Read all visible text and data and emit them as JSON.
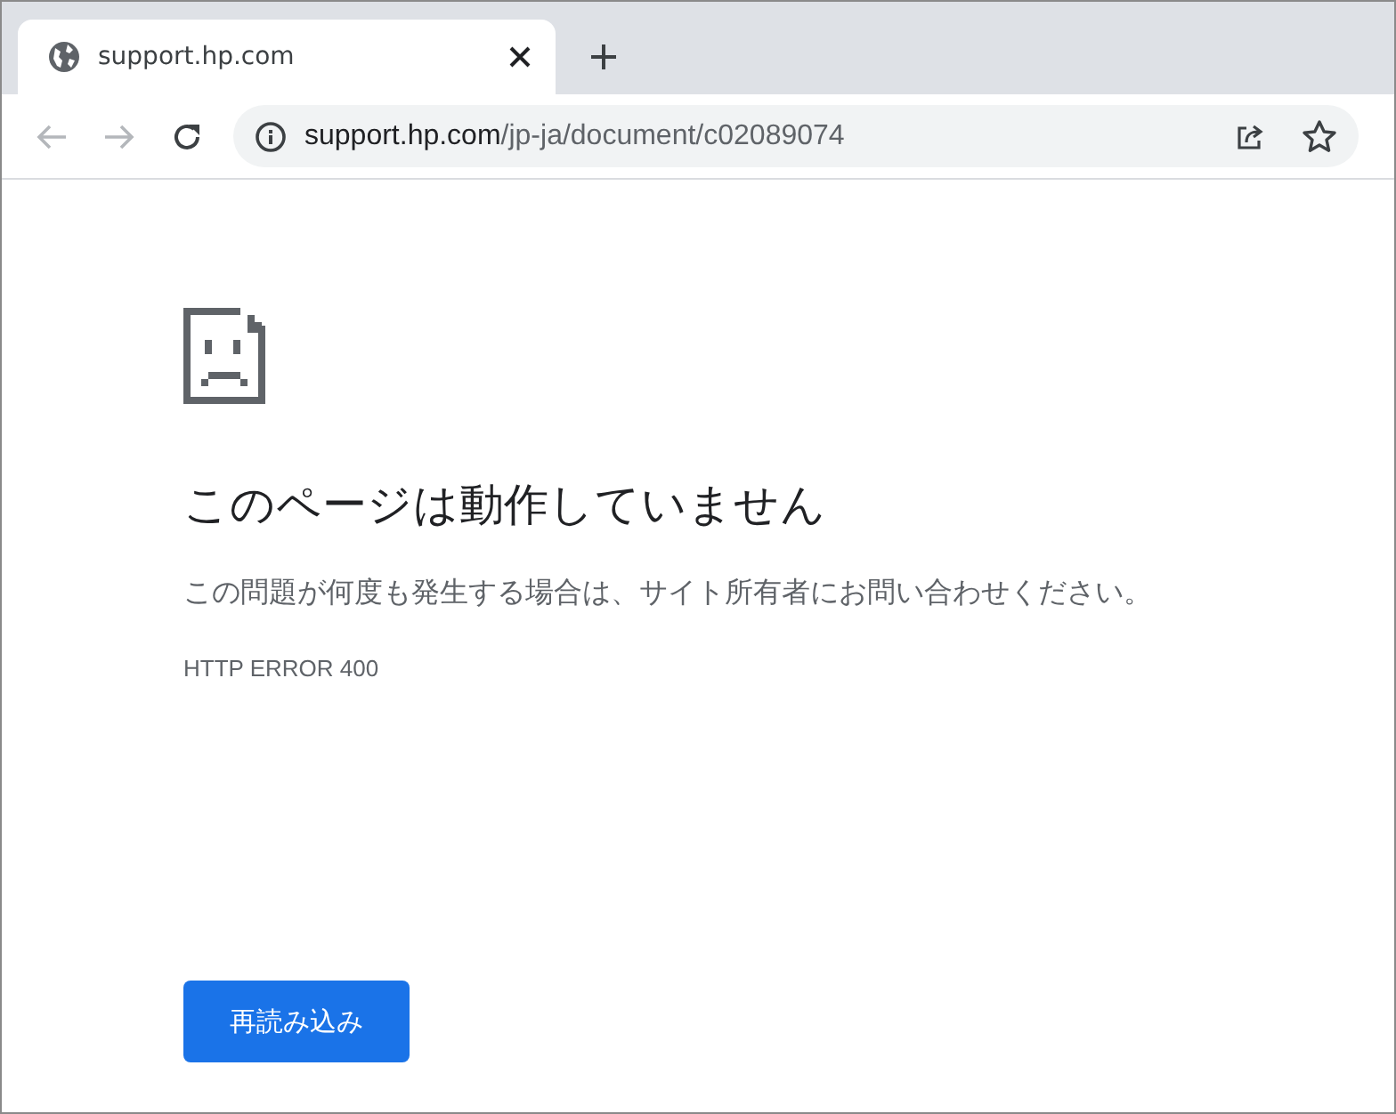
{
  "tabs": [
    {
      "title": "support.hp.com",
      "selected": true
    }
  ],
  "toolbar": {
    "back": {
      "disabled": true
    },
    "forward": {
      "disabled": true
    }
  },
  "address_bar": {
    "host": "support.hp.com",
    "path": "/jp-ja/document/c02089074"
  },
  "error_page": {
    "heading": "このページは動作していません",
    "message": "この問題が何度も発生する場合は、サイト所有者にお問い合わせください。",
    "code": "HTTP ERROR 400",
    "button": "再読み込み"
  }
}
